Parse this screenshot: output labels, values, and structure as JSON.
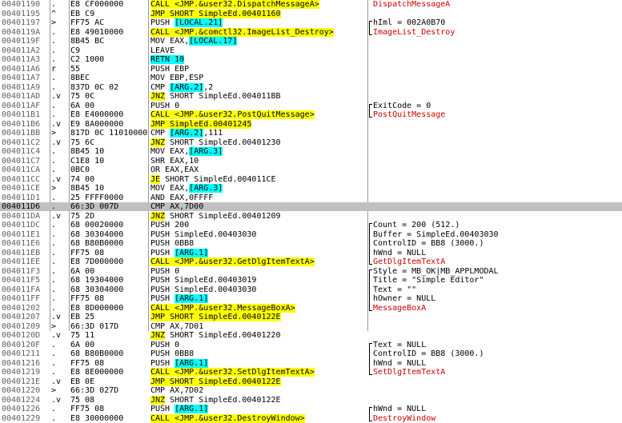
{
  "rows": [
    {
      "addr": "00401190",
      "flag": ".",
      "hex": "E8 CF000000",
      "parts": [
        {
          "t": "CALL",
          "c": "yl"
        },
        {
          "t": " <JMP.&user32.DispatchMessageA>",
          "c": "yl"
        }
      ],
      "comment": [
        {
          "t": "DispatchMessageA",
          "c": "red"
        }
      ]
    },
    {
      "addr": "00401195",
      "flag": "^ ",
      "hex": "EB C9",
      "parts": [
        {
          "t": "JMP SHORT SimpleEd.00401160",
          "c": "yl"
        }
      ],
      "comment": []
    },
    {
      "addr": "00401197",
      "flag": ">",
      "hex": "FF75 AC",
      "parts": [
        {
          "t": "PUSH "
        },
        {
          "t": "[LOCAL.21]",
          "c": "bl"
        }
      ],
      "comment": [
        {
          "t": "hIml = 002A0B70"
        }
      ]
    },
    {
      "addr": "0040119A",
      "flag": ".",
      "hex": "E8 49010000",
      "parts": [
        {
          "t": "CALL",
          "c": "yl"
        },
        {
          "t": " <JMP.&comctl32.ImageList_Destroy>",
          "c": "yl"
        }
      ],
      "comment": [
        {
          "t": "ImageList_Destroy",
          "c": "red"
        }
      ]
    },
    {
      "addr": "0040119F",
      "flag": ".",
      "hex": "8B45 BC",
      "parts": [
        {
          "t": "MOV EAX,"
        },
        {
          "t": "[LOCAL.17]",
          "c": "bl"
        }
      ],
      "comment": []
    },
    {
      "addr": "004011A2",
      "flag": ".",
      "hex": "C9",
      "parts": [
        {
          "t": "LEAVE"
        }
      ],
      "comment": []
    },
    {
      "addr": "004011A3",
      "flag": ".",
      "hex": "C2 1000",
      "parts": [
        {
          "t": "RETN 10",
          "c": "bl"
        }
      ],
      "comment": []
    },
    {
      "addr": "004011A6",
      "flag": "r ",
      "hex": "55",
      "parts": [
        {
          "t": "PUSH EBP"
        }
      ],
      "comment": []
    },
    {
      "addr": "004011A7",
      "flag": ".",
      "hex": "8BEC",
      "parts": [
        {
          "t": "MOV EBP,ESP"
        }
      ],
      "comment": []
    },
    {
      "addr": "004011A9",
      "flag": ".",
      "hex": "837D 0C 02",
      "parts": [
        {
          "t": "CMP "
        },
        {
          "t": "[ARG.2]",
          "c": "bl"
        },
        {
          "t": ",2"
        }
      ],
      "comment": []
    },
    {
      "addr": "004011AD",
      "flag": ".v",
      "hex": "75 0C",
      "parts": [
        {
          "t": "JNZ",
          "c": "yl"
        },
        {
          "t": " SHORT SimpleEd.004011BB"
        }
      ],
      "comment": []
    },
    {
      "addr": "004011AF",
      "flag": ".",
      "hex": "6A 00",
      "parts": [
        {
          "t": "PUSH 0"
        }
      ],
      "comment": [
        {
          "t": "ExitCode = 0"
        }
      ]
    },
    {
      "addr": "004011B1",
      "flag": ".",
      "hex": "E8 E4000000",
      "parts": [
        {
          "t": "CALL",
          "c": "yl"
        },
        {
          "t": " <JMP.&user32.PostQuitMessage>",
          "c": "yl"
        }
      ],
      "comment": [
        {
          "t": "PostQuitMessage",
          "c": "red"
        }
      ]
    },
    {
      "addr": "004011B6",
      "flag": ".v",
      "hex": "E9 8A000000",
      "parts": [
        {
          "t": "JMP SimpleEd.00401245",
          "c": "yl"
        }
      ],
      "comment": []
    },
    {
      "addr": "004011BB",
      "flag": ">",
      "hex": "817D 0C 11010000",
      "parts": [
        {
          "t": "CMP "
        },
        {
          "t": "[ARG.2]",
          "c": "bl"
        },
        {
          "t": ",111"
        }
      ],
      "comment": []
    },
    {
      "addr": "004011C2",
      "flag": ".v",
      "hex": "75 6C",
      "parts": [
        {
          "t": "JNZ",
          "c": "yl"
        },
        {
          "t": " SHORT SimpleEd.00401230"
        }
      ],
      "comment": []
    },
    {
      "addr": "004011C4",
      "flag": ".",
      "hex": "8B45 10",
      "parts": [
        {
          "t": "MOV EAX,"
        },
        {
          "t": "[ARG.3]",
          "c": "bl"
        }
      ],
      "comment": []
    },
    {
      "addr": "004011C7",
      "flag": ".",
      "hex": "C1E8 10",
      "parts": [
        {
          "t": "SHR EAX,10"
        }
      ],
      "comment": []
    },
    {
      "addr": "004011CA",
      "flag": ".",
      "hex": "0BC0",
      "parts": [
        {
          "t": "OR EAX,EAX"
        }
      ],
      "comment": []
    },
    {
      "addr": "004011CC",
      "flag": ".v",
      "hex": "74 00",
      "parts": [
        {
          "t": "JE",
          "c": "yl"
        },
        {
          "t": " SHORT SimpleEd.004011CE"
        }
      ],
      "comment": []
    },
    {
      "addr": "004011CE",
      "flag": ">",
      "hex": "8B45 10",
      "parts": [
        {
          "t": "MOV EAX,"
        },
        {
          "t": "[ARG.3]",
          "c": "bl"
        }
      ],
      "comment": []
    },
    {
      "addr": "004011D1",
      "flag": ".",
      "hex": "25 FFFF0000",
      "parts": [
        {
          "t": "AND EAX,0FFFF"
        }
      ],
      "comment": []
    },
    {
      "addr": "004011D6",
      "flag": ".",
      "hex": "66:3D 007D",
      "parts": [
        {
          "t": "CMP AX,7D00"
        }
      ],
      "comment": [],
      "current": true
    },
    {
      "addr": "004011DA",
      "flag": ".v",
      "hex": "75 2D",
      "parts": [
        {
          "t": "JNZ",
          "c": "yl"
        },
        {
          "t": " SHORT SimpleEd.00401209"
        }
      ],
      "comment": []
    },
    {
      "addr": "004011DC",
      "flag": ".",
      "hex": "68 00020000",
      "parts": [
        {
          "t": "PUSH 200"
        }
      ],
      "comment": [
        {
          "t": "Count = 200 (512.)"
        }
      ]
    },
    {
      "addr": "004011E1",
      "flag": ".",
      "hex": "68 30304000",
      "parts": [
        {
          "t": "PUSH SimpleEd.00403030"
        }
      ],
      "comment": [
        {
          "t": "Buffer = SimpleEd.00403030"
        }
      ]
    },
    {
      "addr": "004011E6",
      "flag": ".",
      "hex": "68 B80B0000",
      "parts": [
        {
          "t": "PUSH 0BB8"
        }
      ],
      "comment": [
        {
          "t": "ControlID = BB8 (3000.)"
        }
      ]
    },
    {
      "addr": "004011EB",
      "flag": ".",
      "hex": "FF75 08",
      "parts": [
        {
          "t": "PUSH "
        },
        {
          "t": "[ARG.1]",
          "c": "bl"
        }
      ],
      "comment": [
        {
          "t": "hWnd = NULL"
        }
      ]
    },
    {
      "addr": "004011EE",
      "flag": ".",
      "hex": "E8 7D000000",
      "parts": [
        {
          "t": "CALL",
          "c": "yl"
        },
        {
          "t": " <JMP.&user32.GetDlgItemTextA>",
          "c": "yl"
        }
      ],
      "comment": [
        {
          "t": "GetDlgItemTextA",
          "c": "red"
        }
      ]
    },
    {
      "addr": "004011F3",
      "flag": ".",
      "hex": "6A 00",
      "parts": [
        {
          "t": "PUSH 0"
        }
      ],
      "comment": [
        {
          "t": "Style = MB_OK|MB_APPLMODAL"
        }
      ]
    },
    {
      "addr": "004011F5",
      "flag": ".",
      "hex": "68 19304000",
      "parts": [
        {
          "t": "PUSH SimpleEd.00403019"
        }
      ],
      "comment": [
        {
          "t": "Title = \"Simple Editor\""
        }
      ]
    },
    {
      "addr": "004011FA",
      "flag": ".",
      "hex": "68 30304000",
      "parts": [
        {
          "t": "PUSH SimpleEd.00403030"
        }
      ],
      "comment": [
        {
          "t": "Text = \"\""
        }
      ]
    },
    {
      "addr": "004011FF",
      "flag": ".",
      "hex": "FF75 08",
      "parts": [
        {
          "t": "PUSH "
        },
        {
          "t": "[ARG.1]",
          "c": "bl"
        }
      ],
      "comment": [
        {
          "t": "hOwner = NULL"
        }
      ]
    },
    {
      "addr": "00401202",
      "flag": ".",
      "hex": "E8 8D000000",
      "parts": [
        {
          "t": "CALL",
          "c": "yl"
        },
        {
          "t": " <JMP.&user32.MessageBoxA>",
          "c": "yl"
        }
      ],
      "comment": [
        {
          "t": "MessageBoxA",
          "c": "red"
        }
      ]
    },
    {
      "addr": "00401207",
      "flag": ".v",
      "hex": "EB 25",
      "parts": [
        {
          "t": "JMP SHORT SimpleEd.0040122E",
          "c": "yl"
        }
      ],
      "comment": []
    },
    {
      "addr": "00401209",
      "flag": ">",
      "hex": "66:3D 017D",
      "parts": [
        {
          "t": "CMP AX,7D01"
        }
      ],
      "comment": []
    },
    {
      "addr": "0040120D",
      "flag": ".v",
      "hex": "75 11",
      "parts": [
        {
          "t": "JNZ",
          "c": "yl"
        },
        {
          "t": " SHORT SimpleEd.00401220"
        }
      ],
      "comment": []
    },
    {
      "addr": "0040120F",
      "flag": ".",
      "hex": "6A 00",
      "parts": [
        {
          "t": "PUSH 0"
        }
      ],
      "comment": [
        {
          "t": "Text = NULL"
        }
      ]
    },
    {
      "addr": "00401211",
      "flag": ".",
      "hex": "68 B80B0000",
      "parts": [
        {
          "t": "PUSH 0BB8"
        }
      ],
      "comment": [
        {
          "t": "ControlID = BB8 (3000.)"
        }
      ]
    },
    {
      "addr": "00401216",
      "flag": ".",
      "hex": "FF75 08",
      "parts": [
        {
          "t": "PUSH "
        },
        {
          "t": "[ARG.1]",
          "c": "bl"
        }
      ],
      "comment": [
        {
          "t": "hWnd = NULL"
        }
      ]
    },
    {
      "addr": "00401219",
      "flag": ".",
      "hex": "E8 8E000000",
      "parts": [
        {
          "t": "CALL",
          "c": "yl"
        },
        {
          "t": " <JMP.&user32.SetDlgItemTextA>",
          "c": "yl"
        }
      ],
      "comment": [
        {
          "t": "SetDlgItemTextA",
          "c": "red"
        }
      ]
    },
    {
      "addr": "0040121E",
      "flag": ".v",
      "hex": "EB 0E",
      "parts": [
        {
          "t": "JMP SHORT SimpleEd.0040122E",
          "c": "yl"
        }
      ],
      "comment": []
    },
    {
      "addr": "00401220",
      "flag": ">",
      "hex": "66:3D 027D",
      "parts": [
        {
          "t": "CMP AX,7D02"
        }
      ],
      "comment": []
    },
    {
      "addr": "00401224",
      "flag": ".v",
      "hex": "75 08",
      "parts": [
        {
          "t": "JNZ",
          "c": "yl"
        },
        {
          "t": " SHORT SimpleEd.0040122E"
        }
      ],
      "comment": []
    },
    {
      "addr": "00401226",
      "flag": ".",
      "hex": "FF75 08",
      "parts": [
        {
          "t": "PUSH "
        },
        {
          "t": "[ARG.1]",
          "c": "bl"
        }
      ],
      "comment": [
        {
          "t": "hWnd = NULL"
        }
      ]
    },
    {
      "addr": "00401229",
      "flag": ".",
      "hex": "E8 30000000",
      "parts": [
        {
          "t": "CALL",
          "c": "yl"
        },
        {
          "t": " <JMP.&user32.DestroyWindow>",
          "c": "yl"
        }
      ],
      "comment": [
        {
          "t": "DestroyWindow",
          "c": "red"
        }
      ]
    }
  ]
}
